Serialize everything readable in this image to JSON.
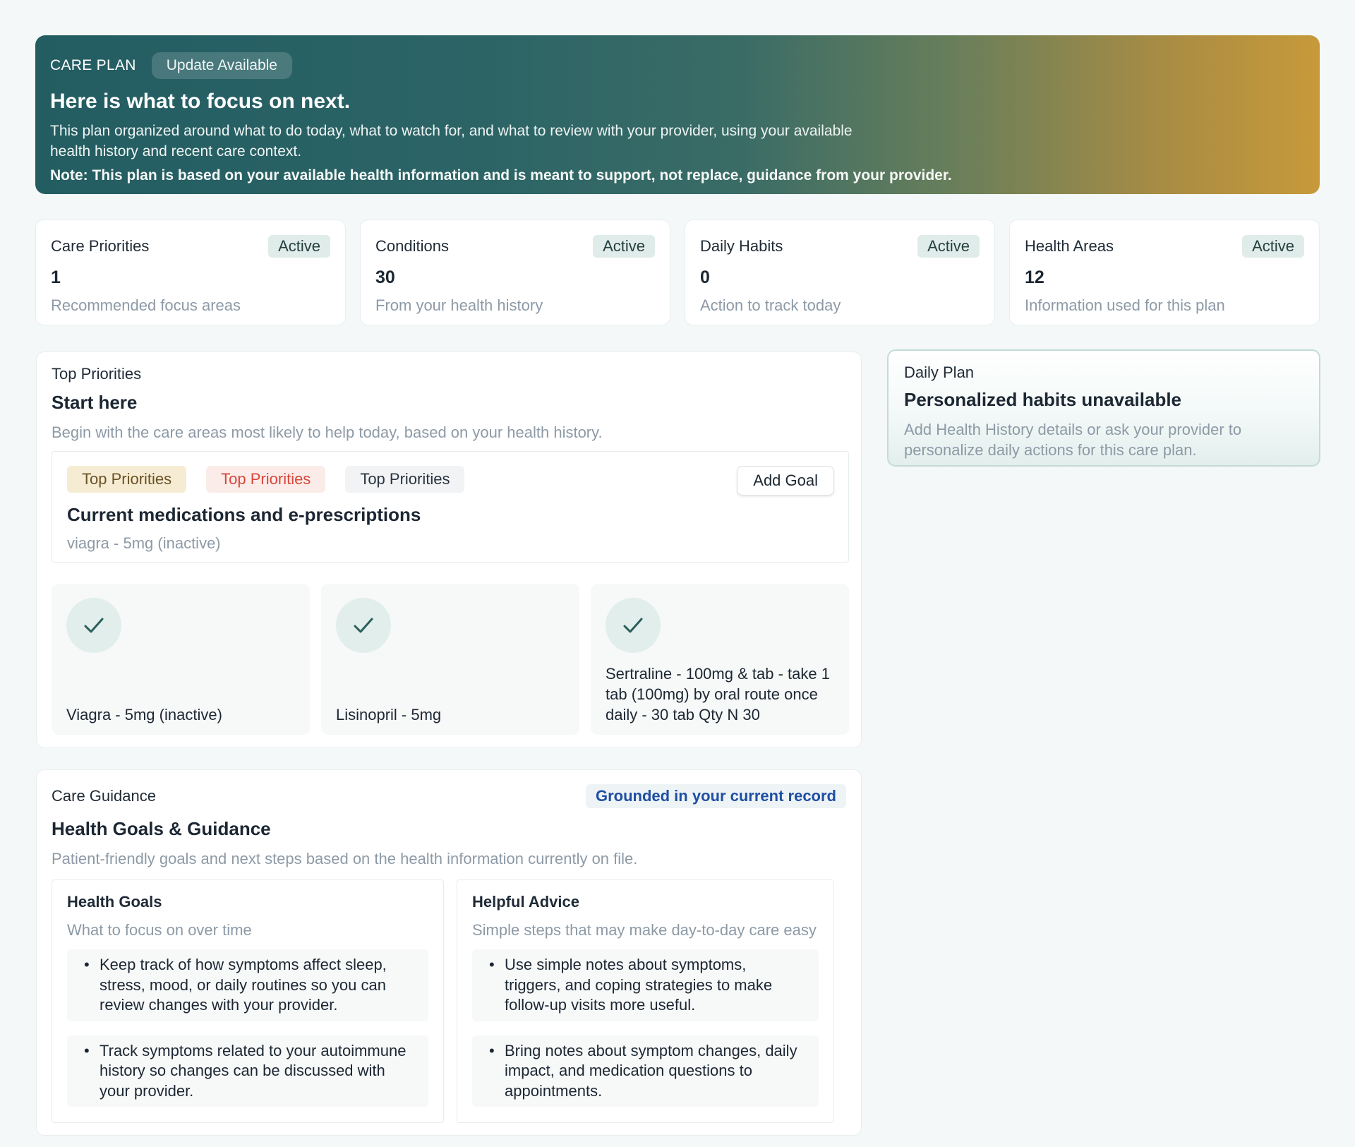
{
  "hero": {
    "label": "CARE PLAN",
    "badge": "Update Available",
    "title": "Here is what to focus on next.",
    "description": "This plan organized around what to do today, what to watch for, and what to review with your provider, using your available health history and recent care context.",
    "note": "Note: This plan is based on your available health information and is meant to support, not replace, guidance from your provider.",
    "gradient_start": "#235d62",
    "gradient_end": "#c79a3a"
  },
  "stats": [
    {
      "title": "Care Priorities",
      "status": "Active",
      "value": "1",
      "subtitle": "Recommended focus areas"
    },
    {
      "title": "Conditions",
      "status": "Active",
      "value": "30",
      "subtitle": "From your health history"
    },
    {
      "title": "Daily Habits",
      "status": "Active",
      "value": "0",
      "subtitle": "Action to track today"
    },
    {
      "title": "Health Areas",
      "status": "Active",
      "value": "12",
      "subtitle": "Information used for this plan"
    }
  ],
  "priorities": {
    "kicker": "Top Priorities",
    "title": "Start here",
    "subtitle": "Begin with the care areas most likely to help today, based on your health history.",
    "chips": [
      "Top Priorities",
      "Top Priorities",
      "Top Priorities"
    ],
    "add_goal_label": "Add Goal",
    "medications_title": "Current medications and e-prescriptions",
    "medications_subtitle": "viagra - 5mg (inactive)",
    "medications": [
      {
        "name": "Viagra - 5mg (inactive)",
        "icon": "check-icon"
      },
      {
        "name": "Lisinopril - 5mg",
        "icon": "check-icon"
      },
      {
        "name": "Sertraline - 100mg & tab - take 1 tab (100mg) by oral route once daily - 30 tab Qty N 30",
        "icon": "check-icon"
      }
    ]
  },
  "daily_plan": {
    "kicker": "Daily Plan",
    "title": "Personalized habits unavailable",
    "subtitle": "Add Health History details or ask your provider to personalize daily actions for this care plan."
  },
  "guidance": {
    "kicker": "Care Guidance",
    "badge": "Grounded in your current record",
    "title": "Health Goals & Guidance",
    "subtitle": "Patient-friendly goals and next steps based on the health information currently on file.",
    "goals": {
      "title": "Health Goals",
      "subtitle": "What to focus on over time",
      "items": [
        "Keep track of how symptoms affect sleep, stress, mood, or daily routines so you can review changes with your provider.",
        "Track symptoms related to your autoimmune history so changes can be discussed with your provider."
      ]
    },
    "advice": {
      "title": "Helpful Advice",
      "subtitle": "Simple steps that may make day-to-day care easy",
      "items": [
        "Use simple notes about symptoms, triggers, and coping strategies to make follow-up visits more useful.",
        "Bring notes about symptom changes, daily impact, and medication questions to appointments."
      ]
    }
  },
  "colors": {
    "accent_teal": "#2c6466",
    "accent_gold": "#c79a3a",
    "chip_red_text": "#d9463a",
    "badge_blue_text": "#1f4fa3"
  }
}
